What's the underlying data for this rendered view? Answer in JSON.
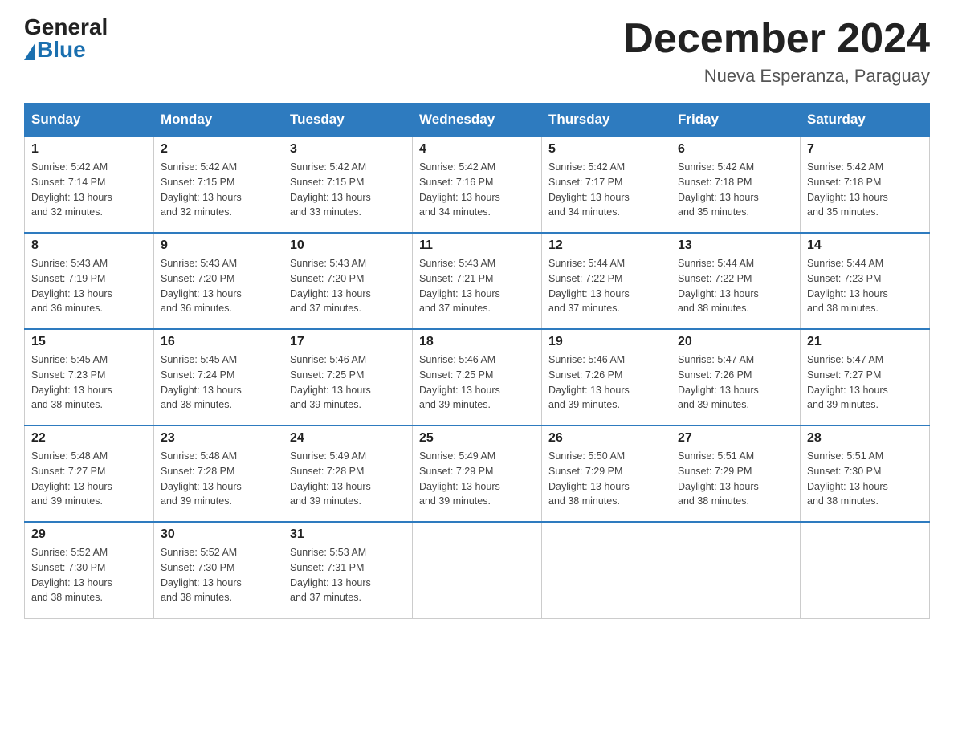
{
  "logo": {
    "general": "General",
    "blue": "Blue"
  },
  "title": "December 2024",
  "location": "Nueva Esperanza, Paraguay",
  "days_of_week": [
    "Sunday",
    "Monday",
    "Tuesday",
    "Wednesday",
    "Thursday",
    "Friday",
    "Saturday"
  ],
  "weeks": [
    [
      {
        "day": "1",
        "sunrise": "5:42 AM",
        "sunset": "7:14 PM",
        "daylight": "13 hours and 32 minutes."
      },
      {
        "day": "2",
        "sunrise": "5:42 AM",
        "sunset": "7:15 PM",
        "daylight": "13 hours and 32 minutes."
      },
      {
        "day": "3",
        "sunrise": "5:42 AM",
        "sunset": "7:15 PM",
        "daylight": "13 hours and 33 minutes."
      },
      {
        "day": "4",
        "sunrise": "5:42 AM",
        "sunset": "7:16 PM",
        "daylight": "13 hours and 34 minutes."
      },
      {
        "day": "5",
        "sunrise": "5:42 AM",
        "sunset": "7:17 PM",
        "daylight": "13 hours and 34 minutes."
      },
      {
        "day": "6",
        "sunrise": "5:42 AM",
        "sunset": "7:18 PM",
        "daylight": "13 hours and 35 minutes."
      },
      {
        "day": "7",
        "sunrise": "5:42 AM",
        "sunset": "7:18 PM",
        "daylight": "13 hours and 35 minutes."
      }
    ],
    [
      {
        "day": "8",
        "sunrise": "5:43 AM",
        "sunset": "7:19 PM",
        "daylight": "13 hours and 36 minutes."
      },
      {
        "day": "9",
        "sunrise": "5:43 AM",
        "sunset": "7:20 PM",
        "daylight": "13 hours and 36 minutes."
      },
      {
        "day": "10",
        "sunrise": "5:43 AM",
        "sunset": "7:20 PM",
        "daylight": "13 hours and 37 minutes."
      },
      {
        "day": "11",
        "sunrise": "5:43 AM",
        "sunset": "7:21 PM",
        "daylight": "13 hours and 37 minutes."
      },
      {
        "day": "12",
        "sunrise": "5:44 AM",
        "sunset": "7:22 PM",
        "daylight": "13 hours and 37 minutes."
      },
      {
        "day": "13",
        "sunrise": "5:44 AM",
        "sunset": "7:22 PM",
        "daylight": "13 hours and 38 minutes."
      },
      {
        "day": "14",
        "sunrise": "5:44 AM",
        "sunset": "7:23 PM",
        "daylight": "13 hours and 38 minutes."
      }
    ],
    [
      {
        "day": "15",
        "sunrise": "5:45 AM",
        "sunset": "7:23 PM",
        "daylight": "13 hours and 38 minutes."
      },
      {
        "day": "16",
        "sunrise": "5:45 AM",
        "sunset": "7:24 PM",
        "daylight": "13 hours and 38 minutes."
      },
      {
        "day": "17",
        "sunrise": "5:46 AM",
        "sunset": "7:25 PM",
        "daylight": "13 hours and 39 minutes."
      },
      {
        "day": "18",
        "sunrise": "5:46 AM",
        "sunset": "7:25 PM",
        "daylight": "13 hours and 39 minutes."
      },
      {
        "day": "19",
        "sunrise": "5:46 AM",
        "sunset": "7:26 PM",
        "daylight": "13 hours and 39 minutes."
      },
      {
        "day": "20",
        "sunrise": "5:47 AM",
        "sunset": "7:26 PM",
        "daylight": "13 hours and 39 minutes."
      },
      {
        "day": "21",
        "sunrise": "5:47 AM",
        "sunset": "7:27 PM",
        "daylight": "13 hours and 39 minutes."
      }
    ],
    [
      {
        "day": "22",
        "sunrise": "5:48 AM",
        "sunset": "7:27 PM",
        "daylight": "13 hours and 39 minutes."
      },
      {
        "day": "23",
        "sunrise": "5:48 AM",
        "sunset": "7:28 PM",
        "daylight": "13 hours and 39 minutes."
      },
      {
        "day": "24",
        "sunrise": "5:49 AM",
        "sunset": "7:28 PM",
        "daylight": "13 hours and 39 minutes."
      },
      {
        "day": "25",
        "sunrise": "5:49 AM",
        "sunset": "7:29 PM",
        "daylight": "13 hours and 39 minutes."
      },
      {
        "day": "26",
        "sunrise": "5:50 AM",
        "sunset": "7:29 PM",
        "daylight": "13 hours and 38 minutes."
      },
      {
        "day": "27",
        "sunrise": "5:51 AM",
        "sunset": "7:29 PM",
        "daylight": "13 hours and 38 minutes."
      },
      {
        "day": "28",
        "sunrise": "5:51 AM",
        "sunset": "7:30 PM",
        "daylight": "13 hours and 38 minutes."
      }
    ],
    [
      {
        "day": "29",
        "sunrise": "5:52 AM",
        "sunset": "7:30 PM",
        "daylight": "13 hours and 38 minutes."
      },
      {
        "day": "30",
        "sunrise": "5:52 AM",
        "sunset": "7:30 PM",
        "daylight": "13 hours and 38 minutes."
      },
      {
        "day": "31",
        "sunrise": "5:53 AM",
        "sunset": "7:31 PM",
        "daylight": "13 hours and 37 minutes."
      },
      null,
      null,
      null,
      null
    ]
  ],
  "labels": {
    "sunrise": "Sunrise:",
    "sunset": "Sunset:",
    "daylight": "Daylight:"
  }
}
